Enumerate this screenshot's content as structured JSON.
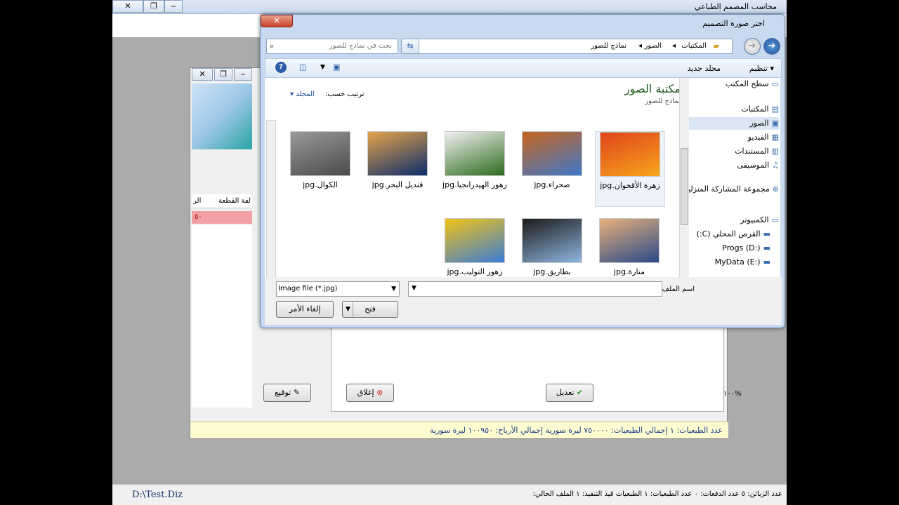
{
  "app": {
    "title": "محاسب المصمم الطباعي",
    "status": {
      "left_path": "D:\\Test.Diz",
      "fields": "عدد الزبائن: ٥   عدد الدفعات: ٠   عدد الطبعيات: ١   الطبعيات قيد التنفيذ: ١   الملف الحالي:"
    }
  },
  "inner_window": {
    "col_header_piece": "لفة القطعة",
    "col_header_r": "الر",
    "row_value": "٥٠",
    "zoom": "١٠٠%",
    "buttons": {
      "sign": "توقيع",
      "close": "إغلاق",
      "edit": "تعديل"
    },
    "summary": "عدد الطبعيات: ١  إجمالي الطبعيات: ٧٥٠٠٠٠ ليرة سورية  إجمالي الأرباح: ١٠٠٩٥٠ ليرة سورية"
  },
  "dialog": {
    "title": "اختر صورة التصميم",
    "close_glyph": "✕",
    "breadcrumb": [
      "المكتبات",
      "الصور",
      "نماذج للصور"
    ],
    "search_placeholder": "بحث في نماذج للصور",
    "commands": {
      "organize": "تنظيم",
      "new_folder": "مجلد جديد"
    },
    "library_title": "مكتبة الصور",
    "library_subtitle": "نماذج للصور",
    "arrange_label": "ترتيب حسب:",
    "arrange_value": "المجلد",
    "nav": [
      {
        "label": "سطح المكتب",
        "icon": "desktop-icon"
      },
      {
        "label": "المكتبات",
        "icon": "libraries-icon"
      },
      {
        "label": "الصور",
        "icon": "pictures-icon",
        "selected": true
      },
      {
        "label": "الفيديو",
        "icon": "video-icon"
      },
      {
        "label": "المستندات",
        "icon": "documents-icon"
      },
      {
        "label": "الموسيقى",
        "icon": "music-icon"
      },
      {
        "label": "مجموعة المشاركة المنزلية",
        "icon": "homegroup-icon"
      },
      {
        "label": "الكمبيوتر",
        "icon": "computer-icon"
      },
      {
        "label": "القرص المحلي (C:)",
        "icon": "drive-icon"
      },
      {
        "label": "Progs (D:)",
        "icon": "drive-icon"
      },
      {
        "label": "MyData (E:)",
        "icon": "drive-icon"
      }
    ],
    "files": [
      {
        "name": "زهرة الأقحوان.jpg",
        "colors": [
          "#e0441b",
          "#f7a51c"
        ],
        "selected": true
      },
      {
        "name": "صحراء.jpg",
        "colors": [
          "#c8651f",
          "#3d78c9"
        ]
      },
      {
        "name": "زهور الهيدرانجيا.jpg",
        "colors": [
          "#f1f1f1",
          "#2e6b1e"
        ]
      },
      {
        "name": "قنديل البحر.jpg",
        "colors": [
          "#e6a34a",
          "#0b2d6c"
        ]
      },
      {
        "name": "الكوال.jpg",
        "colors": [
          "#9a9a9a",
          "#4a4a4a"
        ]
      },
      {
        "name": "منارة.jpg",
        "colors": [
          "#e7b07a",
          "#2a4a8a"
        ]
      },
      {
        "name": "بطاريق.jpg",
        "colors": [
          "#1a1a1a",
          "#8fb6e0"
        ]
      },
      {
        "name": "زهور التوليب.jpg",
        "colors": [
          "#f3c316",
          "#3a7cd6"
        ]
      }
    ],
    "filename_label": "اسم الملف:",
    "filename_value": "",
    "filetype": "Image file (*.jpg)",
    "open": "فتح",
    "cancel": "إلغاء الأمر"
  }
}
